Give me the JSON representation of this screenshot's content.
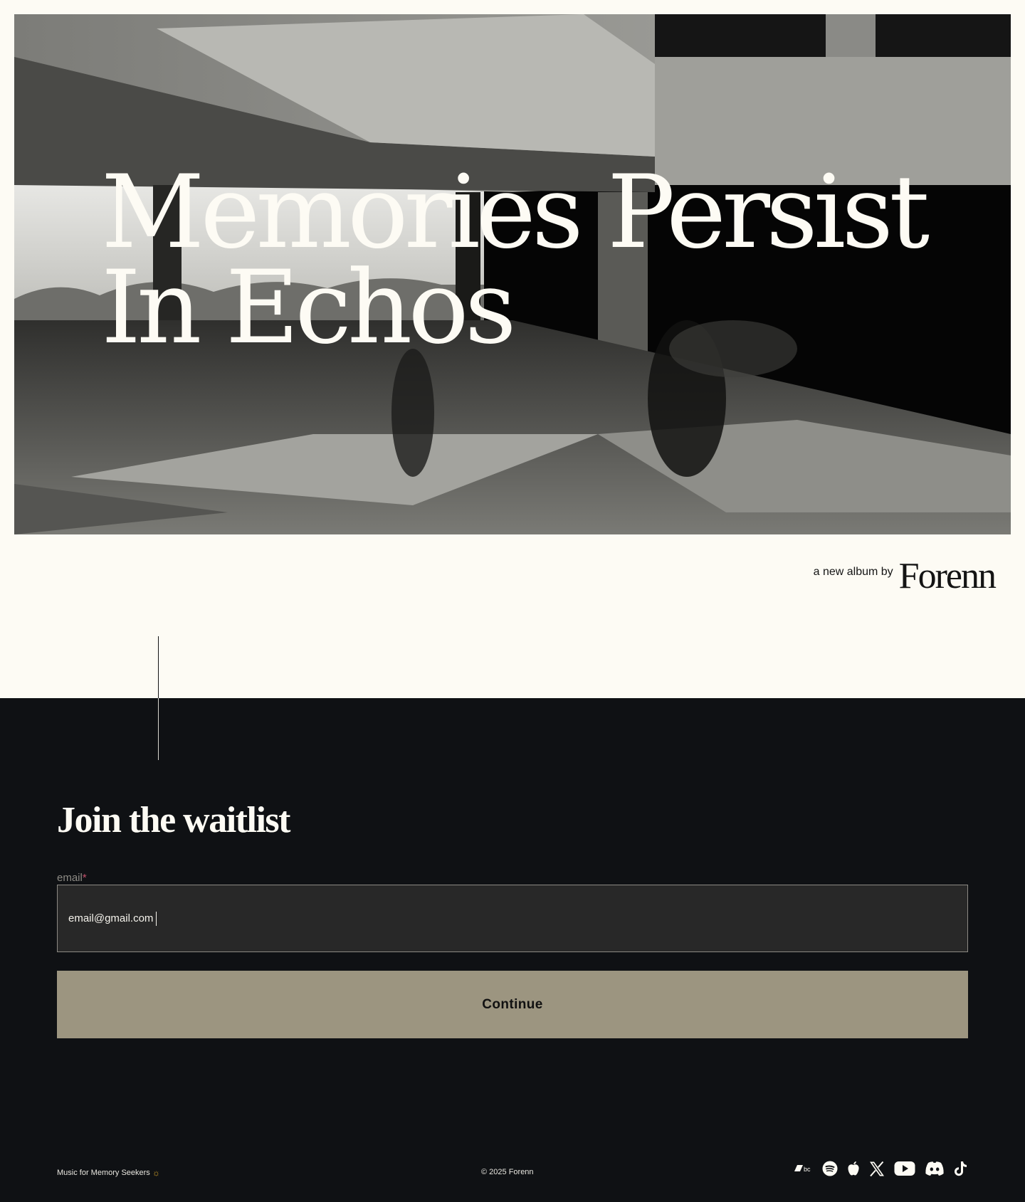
{
  "hero": {
    "title_line1": "Memories Persist",
    "title_line2": "In Echos"
  },
  "byline": {
    "prefix": "a new album by",
    "artist": "Forenn"
  },
  "waitlist": {
    "title": "Join the waitlist",
    "email_label": "email",
    "required_marker": "*",
    "email_value": "email@gmail.com",
    "continue_label": "Continue"
  },
  "footer": {
    "tagline": "Music for Memory Seekers",
    "tagline_icon": "sun-icon",
    "copyright": "© 2025 Forenn",
    "social_icons": [
      "bandcamp-icon",
      "spotify-icon",
      "apple-icon",
      "x-icon",
      "youtube-icon",
      "discord-icon",
      "tiktok-icon"
    ]
  },
  "colors": {
    "background": "#fdfbf4",
    "dark_section": "#0f1114",
    "button": "#9c9580",
    "input": "#282828",
    "required": "#c2506a"
  }
}
